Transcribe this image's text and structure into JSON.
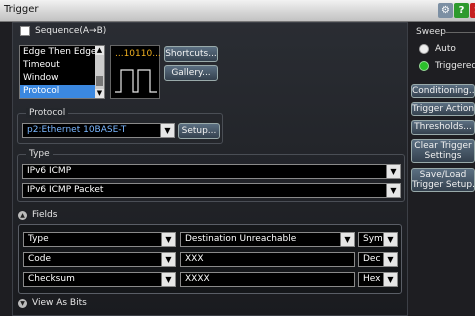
{
  "window": {
    "title": "Trigger"
  },
  "sequence": {
    "label": "Sequence(A→B)",
    "checked": false
  },
  "trigger_types": [
    "Edge Then Edge",
    "Timeout",
    "Window",
    "Protocol"
  ],
  "selected_trigger": "Protocol",
  "pattern_text": "...10110...",
  "buttons": {
    "shortcuts": "Shortcuts...",
    "gallery": "Gallery...",
    "setup": "Setup..."
  },
  "protocol": {
    "label": "Protocol",
    "value": "p2:Ethernet 10BASE-T"
  },
  "type_group": {
    "label": "Type",
    "value1": "IPv6 ICMP",
    "value2": "IPv6 ICMP Packet"
  },
  "fields": {
    "label": "Fields",
    "rows": [
      {
        "name": "Type",
        "value": "Destination Unreachable",
        "format": "Sym"
      },
      {
        "name": "Code",
        "value": "XXX",
        "format": "Dec"
      },
      {
        "name": "Checksum",
        "value": "XXXX",
        "format": "Hex"
      }
    ]
  },
  "view_as_bits": "View As Bits",
  "sweep": {
    "label": "Sweep",
    "options": [
      "Auto",
      "Triggered"
    ],
    "selected": "Triggered"
  },
  "side_buttons": {
    "conditioning": "Conditioning...",
    "trigger_action": "Trigger Action...",
    "thresholds": "Thresholds...",
    "clear_trigger_1": "Clear Trigger",
    "clear_trigger_2": "Settings",
    "save_load_1": "Save/Load",
    "save_load_2": "Trigger Setup..."
  },
  "colors": {
    "selection": "#3b88e0",
    "pattern": "#f0b020",
    "protocol_text": "#7ab7ff"
  }
}
